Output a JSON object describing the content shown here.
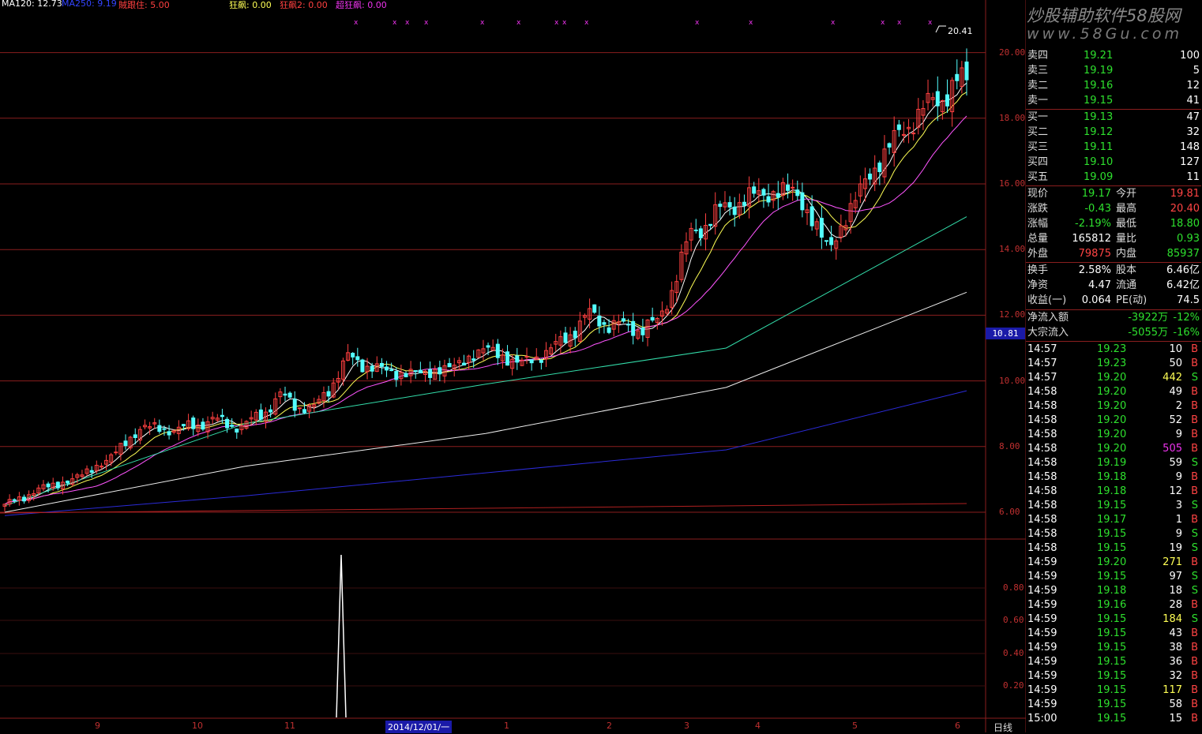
{
  "colors": {
    "up": "#ff4040",
    "down": "#54ffff",
    "grid": "#8a1e1e",
    "ma5": "#ffffff",
    "ma10": "#ffff55",
    "ma20": "#ff55ff",
    "ma60": "#33ddaa",
    "ma120": "#eeeeee",
    "ma250": "#2b2bd8",
    "green": "#2ee02e",
    "red": "#ff4444",
    "magenta": "#ee33ee",
    "white": "#ffffff"
  },
  "indicators": [
    {
      "text": "MA120: 12.73",
      "color": "#ffffff"
    },
    {
      "text": "MA250: 9.19",
      "color": "#3344ff"
    },
    {
      "text": "賊跟住: 5.00",
      "color": "#ff4040"
    },
    {
      "text": "狂飙: 0.00",
      "color": "#ffff55"
    },
    {
      "text": "狂飙2: 0.00",
      "color": "#ff4040"
    },
    {
      "text": "超狂飙: 0.00",
      "color": "#ee33ee"
    }
  ],
  "watermark": {
    "title": "炒股辅助软件58股网",
    "url": "www.58Gu.com"
  },
  "price_axis": {
    "labels": [
      "20.00",
      "18.00",
      "16.00",
      "14.00",
      "12.00",
      "10.00",
      "8.00",
      "6.00"
    ]
  },
  "current_price_marker": "10.81",
  "high_annotation": "20.41",
  "sub_axis": {
    "labels": [
      "0.80",
      "0.60",
      "0.40",
      "0.20"
    ]
  },
  "x_axis": {
    "labels": [
      "9",
      "10",
      "11",
      "2014/12/01/一",
      "1",
      "2",
      "3",
      "4",
      "5",
      "6"
    ]
  },
  "period_label": "日线",
  "order_book": {
    "sells": [
      {
        "label": "卖四",
        "price": "19.21",
        "vol": "100"
      },
      {
        "label": "卖三",
        "price": "19.19",
        "vol": "5"
      },
      {
        "label": "卖二",
        "price": "19.16",
        "vol": "12"
      },
      {
        "label": "卖一",
        "price": "19.15",
        "vol": "41"
      }
    ],
    "buys": [
      {
        "label": "买一",
        "price": "19.13",
        "vol": "47"
      },
      {
        "label": "买二",
        "price": "19.12",
        "vol": "32"
      },
      {
        "label": "买三",
        "price": "19.11",
        "vol": "148"
      },
      {
        "label": "买四",
        "price": "19.10",
        "vol": "127"
      },
      {
        "label": "买五",
        "price": "19.09",
        "vol": "11"
      }
    ]
  },
  "quote_stats": [
    {
      "l1": "现价",
      "v1": "19.17",
      "c1": "#2ee02e",
      "l2": "今开",
      "v2": "19.81",
      "c2": "#ff4444"
    },
    {
      "l1": "涨跌",
      "v1": "-0.43",
      "c1": "#2ee02e",
      "l2": "最高",
      "v2": "20.40",
      "c2": "#ff4444"
    },
    {
      "l1": "涨幅",
      "v1": "-2.19%",
      "c1": "#2ee02e",
      "l2": "最低",
      "v2": "18.80",
      "c2": "#2ee02e"
    },
    {
      "l1": "总量",
      "v1": "165812",
      "c1": "#ffffff",
      "l2": "量比",
      "v2": "0.93",
      "c2": "#2ee02e"
    },
    {
      "l1": "外盘",
      "v1": "79875",
      "c1": "#ff4444",
      "l2": "内盘",
      "v2": "85937",
      "c2": "#2ee02e"
    }
  ],
  "fundamentals": [
    {
      "l1": "换手",
      "v1": "2.58%",
      "l2": "股本",
      "v2": "6.46亿"
    },
    {
      "l1": "净资",
      "v1": "4.47",
      "l2": "流通",
      "v2": "6.42亿"
    },
    {
      "l1": "收益(一)",
      "v1": "0.064",
      "l2": "PE(动)",
      "v2": "74.5"
    }
  ],
  "flows": [
    {
      "label": "净流入额",
      "amount": "-3922万",
      "pct": "-12%"
    },
    {
      "label": "大宗流入",
      "amount": "-5055万",
      "pct": "-16%"
    }
  ],
  "ticks": [
    {
      "time": "14:57",
      "price": "19.23",
      "vol": "10",
      "side": "B",
      "pc": "#2ee02e",
      "vc": "#ffffff"
    },
    {
      "time": "14:57",
      "price": "19.23",
      "vol": "50",
      "side": "B",
      "pc": "#2ee02e",
      "vc": "#ffffff"
    },
    {
      "time": "14:57",
      "price": "19.20",
      "vol": "442",
      "side": "S",
      "pc": "#2ee02e",
      "vc": "#ffff55"
    },
    {
      "time": "14:58",
      "price": "19.20",
      "vol": "49",
      "side": "B",
      "pc": "#2ee02e",
      "vc": "#ffffff"
    },
    {
      "time": "14:58",
      "price": "19.20",
      "vol": "2",
      "side": "B",
      "pc": "#2ee02e",
      "vc": "#ffffff"
    },
    {
      "time": "14:58",
      "price": "19.20",
      "vol": "52",
      "side": "B",
      "pc": "#2ee02e",
      "vc": "#ffffff"
    },
    {
      "time": "14:58",
      "price": "19.20",
      "vol": "9",
      "side": "B",
      "pc": "#2ee02e",
      "vc": "#ffffff"
    },
    {
      "time": "14:58",
      "price": "19.20",
      "vol": "505",
      "side": "B",
      "pc": "#2ee02e",
      "vc": "#ee33ee"
    },
    {
      "time": "14:58",
      "price": "19.19",
      "vol": "59",
      "side": "S",
      "pc": "#2ee02e",
      "vc": "#ffffff"
    },
    {
      "time": "14:58",
      "price": "19.18",
      "vol": "9",
      "side": "B",
      "pc": "#2ee02e",
      "vc": "#ffffff"
    },
    {
      "time": "14:58",
      "price": "19.18",
      "vol": "12",
      "side": "B",
      "pc": "#2ee02e",
      "vc": "#ffffff"
    },
    {
      "time": "14:58",
      "price": "19.15",
      "vol": "3",
      "side": "S",
      "pc": "#2ee02e",
      "vc": "#ffffff"
    },
    {
      "time": "14:58",
      "price": "19.17",
      "vol": "1",
      "side": "B",
      "pc": "#2ee02e",
      "vc": "#ffffff"
    },
    {
      "time": "14:58",
      "price": "19.15",
      "vol": "9",
      "side": "S",
      "pc": "#2ee02e",
      "vc": "#ffffff"
    },
    {
      "time": "14:58",
      "price": "19.15",
      "vol": "19",
      "side": "S",
      "pc": "#2ee02e",
      "vc": "#ffffff"
    },
    {
      "time": "14:59",
      "price": "19.20",
      "vol": "271",
      "side": "B",
      "pc": "#2ee02e",
      "vc": "#ffff55"
    },
    {
      "time": "14:59",
      "price": "19.15",
      "vol": "97",
      "side": "S",
      "pc": "#2ee02e",
      "vc": "#ffffff"
    },
    {
      "time": "14:59",
      "price": "19.18",
      "vol": "18",
      "side": "S",
      "pc": "#2ee02e",
      "vc": "#ffffff"
    },
    {
      "time": "14:59",
      "price": "19.16",
      "vol": "28",
      "side": "B",
      "pc": "#2ee02e",
      "vc": "#ffffff"
    },
    {
      "time": "14:59",
      "price": "19.15",
      "vol": "184",
      "side": "S",
      "pc": "#2ee02e",
      "vc": "#ffff55"
    },
    {
      "time": "14:59",
      "price": "19.15",
      "vol": "43",
      "side": "B",
      "pc": "#2ee02e",
      "vc": "#ffffff"
    },
    {
      "time": "14:59",
      "price": "19.15",
      "vol": "38",
      "side": "B",
      "pc": "#2ee02e",
      "vc": "#ffffff"
    },
    {
      "time": "14:59",
      "price": "19.15",
      "vol": "36",
      "side": "B",
      "pc": "#2ee02e",
      "vc": "#ffffff"
    },
    {
      "time": "14:59",
      "price": "19.15",
      "vol": "32",
      "side": "B",
      "pc": "#2ee02e",
      "vc": "#ffffff"
    },
    {
      "time": "14:59",
      "price": "19.15",
      "vol": "117",
      "side": "B",
      "pc": "#2ee02e",
      "vc": "#ffff55"
    },
    {
      "time": "14:59",
      "price": "19.15",
      "vol": "58",
      "side": "B",
      "pc": "#2ee02e",
      "vc": "#ffffff"
    },
    {
      "time": "15:00",
      "price": "19.15",
      "vol": "15",
      "side": "B",
      "pc": "#2ee02e",
      "vc": "#ffffff"
    }
  ],
  "chart_data": {
    "type": "candlestick",
    "price_range": [
      5.0,
      20.4
    ],
    "sub_range": [
      0,
      1
    ],
    "key_closes": [
      6.2,
      6.7,
      7.0,
      7.6,
      8.6,
      8.5,
      8.8,
      8.6,
      9.5,
      9.1,
      10.7,
      10.3,
      10.2,
      10.4,
      11.0,
      10.5,
      11.0,
      12.0,
      11.6,
      11.7,
      14.5,
      15.3,
      15.7,
      15.8,
      14.0,
      16.0,
      17.5,
      18.5,
      19.2
    ],
    "ma_levels": {
      "ma60": [
        6.2,
        8.7,
        9.9,
        11.0,
        15.0
      ],
      "ma120": [
        6.0,
        7.4,
        8.4,
        9.8,
        12.7
      ],
      "ma250": [
        5.9,
        6.5,
        7.2,
        7.9,
        9.7
      ]
    },
    "spike": {
      "position": "mid-November 2014",
      "value": 1.0
    }
  }
}
